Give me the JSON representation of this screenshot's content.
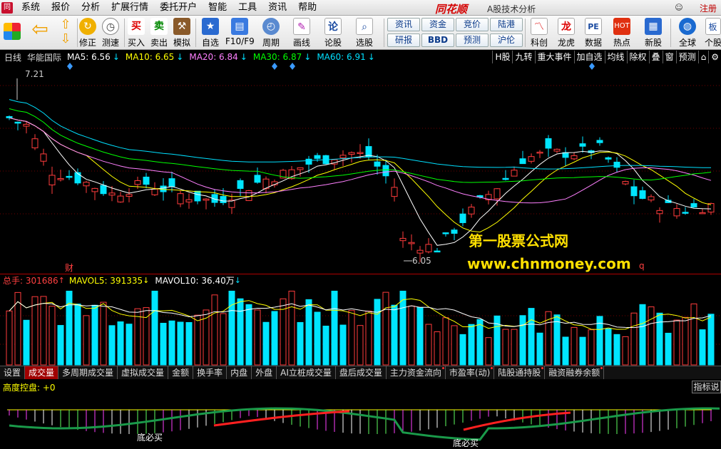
{
  "menu": [
    "系统",
    "报价",
    "分析",
    "扩展行情",
    "委托开户",
    "智能",
    "工具",
    "资讯",
    "帮助"
  ],
  "brand": "同花顺",
  "brand_sub": "A股技术分析",
  "register": "注册",
  "toolbar": {
    "buttons": [
      {
        "label": "修正",
        "icon": "circle-arrow-icon"
      },
      {
        "label": "测速",
        "icon": "clock-icon"
      },
      {
        "label": "买入",
        "icon": "buy-icon",
        "glyph": "买"
      },
      {
        "label": "卖出",
        "icon": "sell-icon",
        "glyph": "卖"
      },
      {
        "label": "模拟",
        "icon": "hammer-icon"
      },
      {
        "label": "自选",
        "icon": "star-icon"
      },
      {
        "label": "F10/F9",
        "icon": "document-icon"
      },
      {
        "label": "周期",
        "icon": "clock-cycle-icon"
      },
      {
        "label": "画线",
        "icon": "pencil-icon"
      },
      {
        "label": "论股",
        "icon": "discuss-icon"
      },
      {
        "label": "选股",
        "icon": "magnifier-icon"
      },
      {
        "label": "科创",
        "icon": "chart-icon"
      },
      {
        "label": "龙虎",
        "icon": "dragon-icon"
      },
      {
        "label": "数据",
        "icon": "pe-icon",
        "glyph": "PE"
      },
      {
        "label": "热点",
        "icon": "hot-icon"
      },
      {
        "label": "新股",
        "icon": "new-stock-icon"
      },
      {
        "label": "全球",
        "icon": "globe-icon"
      },
      {
        "label": "个股",
        "icon": "board-icon",
        "glyph": "板"
      }
    ],
    "small_buttons": [
      "资讯",
      "研报",
      "资金",
      "BBD",
      "竞价",
      "预测",
      "陆港",
      "沪伦"
    ]
  },
  "chart": {
    "period": "日线",
    "stock_name": "华能国际",
    "ma": [
      {
        "label": "MA5: 6.56",
        "color": "#ffffff"
      },
      {
        "label": "MA10: 6.65",
        "color": "#ffff00"
      },
      {
        "label": "MA20: 6.84",
        "color": "#ff80ff"
      },
      {
        "label": "MA30: 6.87",
        "color": "#00ff00"
      },
      {
        "label": "MA60: 6.91",
        "color": "#00e0ff"
      }
    ],
    "right_tabs": [
      "H股",
      "九转",
      "重大事件",
      "加自选",
      "均线",
      "除权",
      "叠",
      "窗",
      "预测"
    ],
    "high_label": "7.21",
    "low_label": "6.05",
    "cai_marker": "财",
    "q_marker": "q"
  },
  "volume": {
    "label": "总手: 301686",
    "mavol5": "MAVOL5: 391335",
    "mavol10": "MAVOL10: 36.40万"
  },
  "indicator_tabs": [
    "设置",
    "成交量",
    "多周期成交量",
    "虚拟成交量",
    "金额",
    "换手率",
    "内盘",
    "外盘",
    "AI立桩成交量",
    "盘后成交量",
    "主力资金流向",
    "市盈率(动)",
    "陆股通持股",
    "融资融券余额"
  ],
  "indicator_help": "指标说",
  "bottom": {
    "label": "高度控盘: +0",
    "annotations": [
      "底必买",
      "底必买"
    ]
  },
  "watermark": {
    "line1": "第一股票公式网",
    "line2": "www.chnmoney.com"
  },
  "colors": {
    "up": "#ff3c3c",
    "down": "#00e5ff",
    "bg": "#000000"
  }
}
